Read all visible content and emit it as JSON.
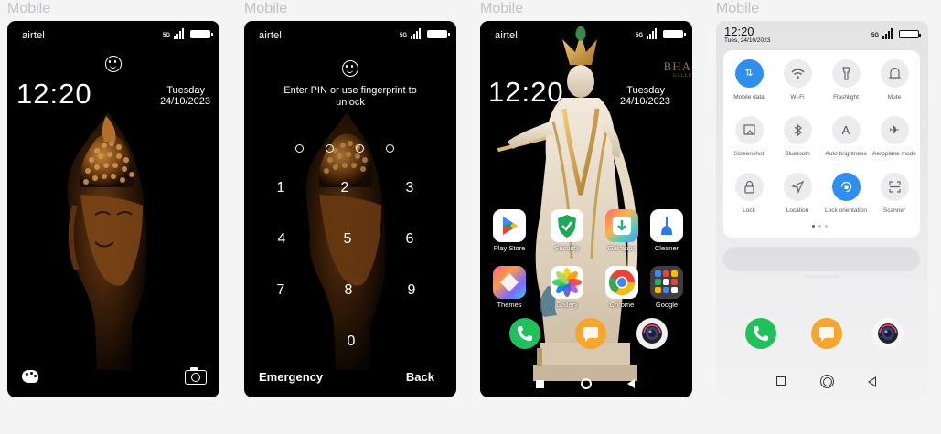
{
  "frames": [
    {
      "label": "Mobile"
    },
    {
      "label": "Mobile"
    },
    {
      "label": "Mobile"
    },
    {
      "label": "Mobile"
    }
  ],
  "status": {
    "carrier": "airtel",
    "network": "5G"
  },
  "lock_screen": {
    "time": "12:20",
    "day": "Tuesday",
    "date": "24/10/2023",
    "icons": [
      "smiley-icon",
      "palette-icon",
      "camera-icon"
    ]
  },
  "pin_screen": {
    "prompt": "Enter PIN or use fingerprint to unlock",
    "keys": [
      "1",
      "2",
      "3",
      "4",
      "5",
      "6",
      "7",
      "8",
      "9",
      "0"
    ],
    "emergency": "Emergency",
    "back": "Back"
  },
  "home_screen": {
    "time": "12:20",
    "day": "Tuesday",
    "date": "24/10/2023",
    "watermark": "BHA",
    "watermark_sub": "GALLE",
    "apps": [
      {
        "label": "Play Store"
      },
      {
        "label": "Security"
      },
      {
        "label": "Get apps"
      },
      {
        "label": "Cleaner"
      },
      {
        "label": "Themes"
      },
      {
        "label": "Gallery"
      },
      {
        "label": "Chrome"
      },
      {
        "label": "Google"
      }
    ],
    "dock": [
      "phone-icon",
      "messages-icon",
      "camera-icon"
    ]
  },
  "control_center": {
    "time": "12:20",
    "date": "Tues, 24/10/2023",
    "tiles": [
      {
        "label": "Mobile data",
        "icon": "mobile-data-icon",
        "on": true
      },
      {
        "label": "Wi-Fi",
        "icon": "wifi-icon",
        "on": false
      },
      {
        "label": "Flashlight",
        "icon": "flashlight-icon",
        "on": false
      },
      {
        "label": "Mute",
        "icon": "bell-icon",
        "on": false
      },
      {
        "label": "Screenshot",
        "icon": "screenshot-icon",
        "on": false
      },
      {
        "label": "Bluetooth",
        "icon": "bluetooth-icon",
        "on": false
      },
      {
        "label": "Auto brightness",
        "icon": "brightness-icon",
        "on": false
      },
      {
        "label": "Aeroplane mode",
        "icon": "airplane-icon",
        "on": false
      },
      {
        "label": "Lock",
        "icon": "lock-icon",
        "on": false
      },
      {
        "label": "Location",
        "icon": "location-icon",
        "on": false
      },
      {
        "label": "Lock orientation",
        "icon": "orientation-lock-icon",
        "on": true
      },
      {
        "label": "Scanner",
        "icon": "scanner-icon",
        "on": false
      }
    ],
    "dock": [
      "phone-icon",
      "messages-icon",
      "camera-icon"
    ]
  },
  "colors": {
    "accent_blue": "#2f8ff0",
    "phone_green": "#20c05c",
    "messages_orange": "#f7a52c"
  }
}
